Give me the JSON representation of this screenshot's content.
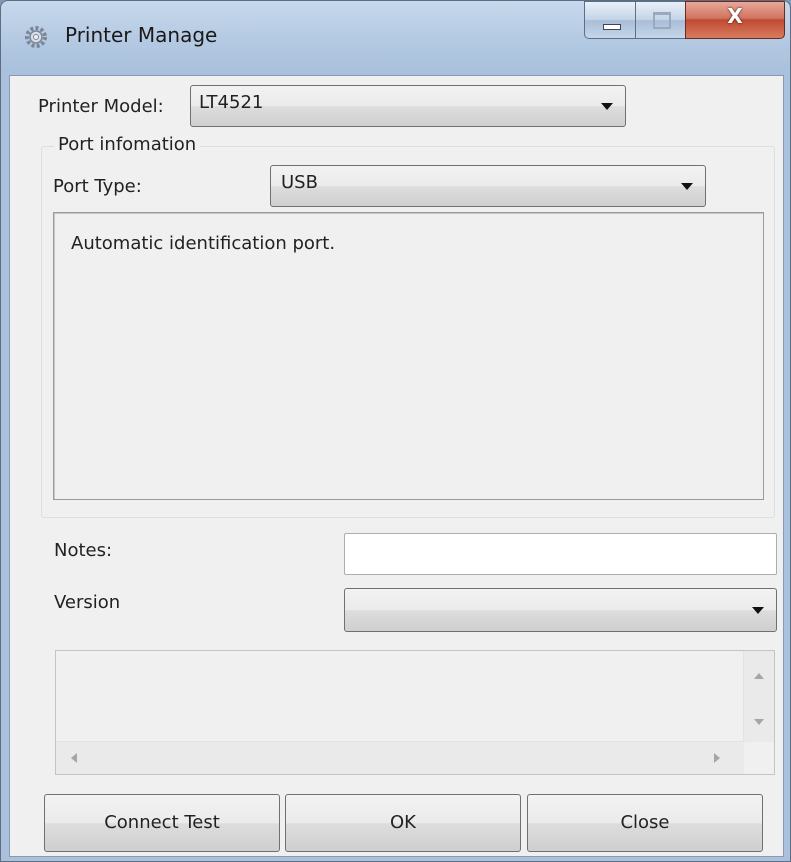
{
  "window": {
    "title": "Printer Manage",
    "close_symbol": "X"
  },
  "printer_model": {
    "label": "Printer Model:",
    "value": "LT4521"
  },
  "port_info": {
    "group_title": "Port infomation",
    "port_type_label": "Port Type:",
    "port_type_value": "USB",
    "description": "Automatic identification port."
  },
  "notes": {
    "label": "Notes:",
    "value": ""
  },
  "version": {
    "label": "Version",
    "value": ""
  },
  "buttons": {
    "connect_test": "Connect Test",
    "ok": "OK",
    "close": "Close"
  },
  "icons": {
    "app": "gear-icon",
    "minimize": "minimize-icon",
    "maximize": "maximize-icon",
    "close": "close-icon"
  }
}
